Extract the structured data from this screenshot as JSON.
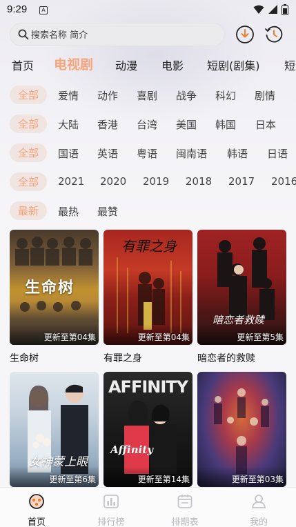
{
  "status_bar": {
    "time": "9:29",
    "notif_badge": "A"
  },
  "search": {
    "placeholder": "搜索名称 简介"
  },
  "top_icons": [
    "download-icon",
    "history-icon"
  ],
  "categories": [
    "首页",
    "电视剧",
    "动漫",
    "电影",
    "短剧(剧集)",
    "短"
  ],
  "active_category": "电视剧",
  "filters": {
    "genre": [
      "全部",
      "爱情",
      "动作",
      "喜剧",
      "战争",
      "科幻",
      "剧情"
    ],
    "region": [
      "全部",
      "大陆",
      "香港",
      "台湾",
      "美国",
      "韩国",
      "日本"
    ],
    "language": [
      "全部",
      "国语",
      "英语",
      "粤语",
      "闽南语",
      "韩语",
      "日语"
    ],
    "year": [
      "全部",
      "2021",
      "2020",
      "2019",
      "2018",
      "2017",
      "2016"
    ],
    "sort": [
      "最新",
      "最热",
      "最赞"
    ]
  },
  "shows": [
    {
      "title": "生命树",
      "update": "更新至第04集",
      "poster_text": "生命树",
      "colors": [
        "#6a5138",
        "#c79a3a",
        "#3b3a35"
      ]
    },
    {
      "title": "有罪之身",
      "update": "更新至第04集",
      "poster_text": "有罪之身",
      "colors": [
        "#8f1f1a",
        "#c23a25",
        "#5a1410"
      ]
    },
    {
      "title": "暗恋者的救赎",
      "update": "更新至第5集",
      "poster_text": "暗恋者救赎",
      "colors": [
        "#7a1c1c",
        "#b82a2a",
        "#2a1414"
      ]
    },
    {
      "title": "",
      "update": "更新至第6集",
      "poster_text": "女神蒙上眼",
      "colors": [
        "#c9d6e2",
        "#8fa7bd",
        "#3d4f63"
      ]
    },
    {
      "title": "",
      "update": "更新至第14集",
      "poster_text": "AFFINITY",
      "colors": [
        "#1e1e1e",
        "#3a3a3a",
        "#0d0d0d"
      ]
    },
    {
      "title": "",
      "update": "更新至第03集",
      "poster_text": "",
      "colors": [
        "#2b3a6a",
        "#c43b3b",
        "#1a1f3a"
      ]
    }
  ],
  "bottom_nav": [
    {
      "label": "首页",
      "icon": "home-icon",
      "active": true
    },
    {
      "label": "排行榜",
      "icon": "chart-icon",
      "active": false
    },
    {
      "label": "排期表",
      "icon": "calendar-icon",
      "active": false
    },
    {
      "label": "我的",
      "icon": "profile-icon",
      "active": false
    }
  ],
  "accent_color": "#f5a27c"
}
